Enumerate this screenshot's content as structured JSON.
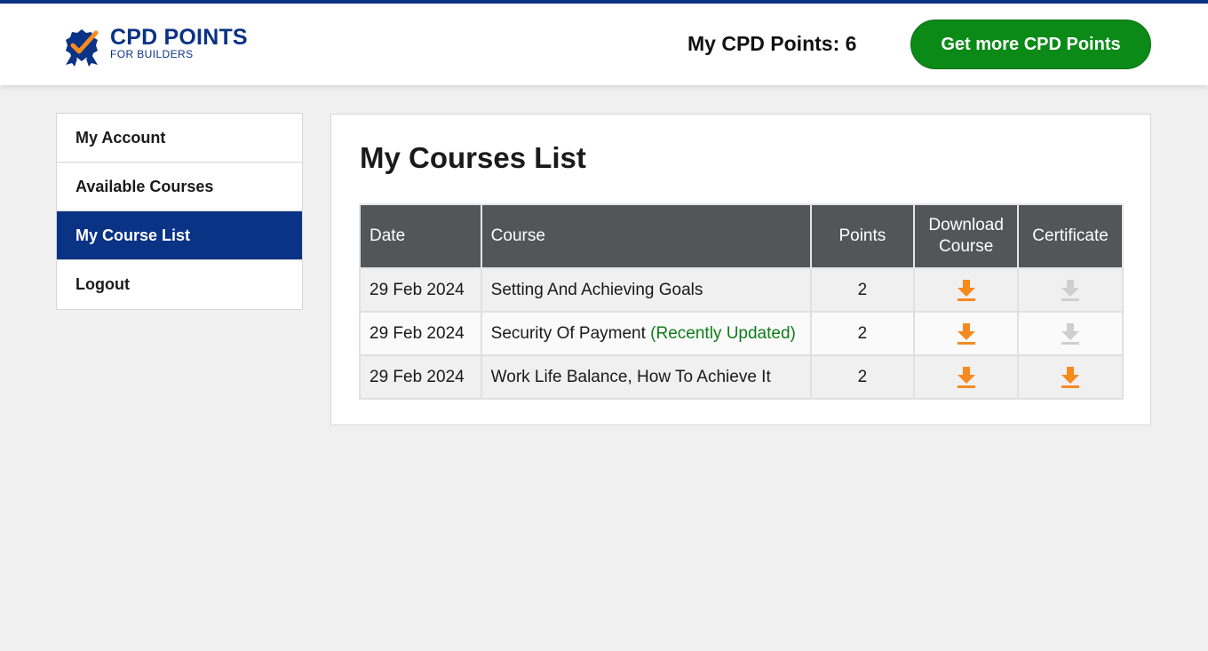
{
  "header": {
    "logo_title": "CPD POINTS",
    "logo_subtitle": "FOR BUILDERS",
    "points_label": "My CPD Points: 6",
    "cta_label": "Get more CPD Points"
  },
  "sidebar": {
    "items": [
      {
        "label": "My Account",
        "active": false
      },
      {
        "label": "Available Courses",
        "active": false
      },
      {
        "label": "My Course List",
        "active": true
      },
      {
        "label": "Logout",
        "active": false
      }
    ]
  },
  "main": {
    "title": "My Courses List",
    "table": {
      "headers": [
        "Date",
        "Course",
        "Points",
        "Download Course",
        "Certificate"
      ],
      "rows": [
        {
          "date": "29 Feb 2024",
          "course": "Setting And Achieving Goals",
          "note": "",
          "points": "2",
          "download": "download-icon",
          "certificate": "download-icon-disabled"
        },
        {
          "date": "29 Feb 2024",
          "course": "Security Of Payment",
          "note": "(Recently Updated)",
          "points": "2",
          "download": "download-icon",
          "certificate": "download-icon-disabled"
        },
        {
          "date": "29 Feb 2024",
          "course": "Work Life Balance, How To Achieve It",
          "note": "",
          "points": "2",
          "download": "download-icon",
          "certificate": "download-icon"
        }
      ]
    }
  },
  "colors": {
    "brand_blue": "#0a3285",
    "cta_green": "#0b8a17",
    "header_gray": "#535559",
    "icon_orange": "#f58a1f",
    "icon_disabled": "#cfcfcf",
    "updated_green": "#0f7d19"
  }
}
